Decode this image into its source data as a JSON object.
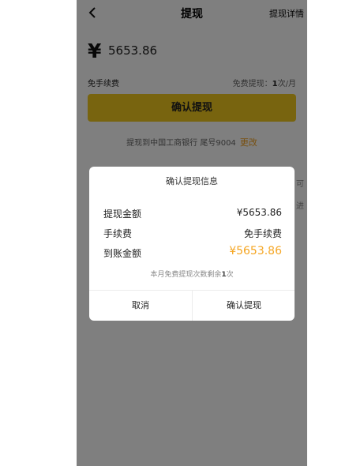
{
  "header": {
    "title": "提现",
    "detail_link": "提现详情"
  },
  "amount": {
    "currency_symbol": "¥",
    "value": "5653.86"
  },
  "fee": {
    "label": "免手续费",
    "quota_prefix": "免费提现：",
    "quota_count": "1",
    "quota_suffix": "次/月"
  },
  "confirm_button": "确认提现",
  "bank": {
    "text": "提现到中国工商银行 尾号9004",
    "change": "更改"
  },
  "background_fragments": [
    "可",
    "进"
  ],
  "dialog": {
    "title": "确认提现信息",
    "rows": [
      {
        "label": "提现金额",
        "value": "¥5653.86"
      },
      {
        "label": "手续费",
        "value": "免手续费"
      },
      {
        "label": "到账金额",
        "value": "¥5653.86"
      }
    ],
    "note_prefix": "本月免费提现次数剩余",
    "note_count": "1",
    "note_suffix": "次",
    "cancel": "取消",
    "confirm": "确认提现"
  },
  "colors": {
    "accent": "#f0c81f",
    "highlight": "#f5a623",
    "overlay": "rgba(0,0,0,0.5)"
  }
}
